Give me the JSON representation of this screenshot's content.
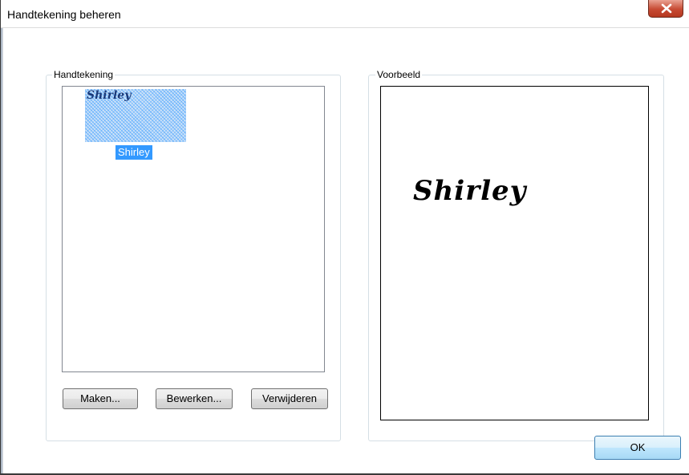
{
  "window": {
    "title": "Handtekening beheren"
  },
  "signature_group": {
    "label": "Handtekening",
    "items": [
      {
        "label": "Shirley",
        "thumbnail_text": "Shirley",
        "selected": true
      }
    ],
    "buttons": {
      "create": "Maken...",
      "edit": "Bewerken...",
      "delete": "Verwijderen"
    }
  },
  "preview_group": {
    "label": "Voorbeeld",
    "signature_text": "Shirley"
  },
  "footer": {
    "ok_label": "OK"
  },
  "colors": {
    "selection": "#3399ff",
    "close_button": "#c74a33"
  },
  "icons": {
    "close": "close-icon"
  }
}
